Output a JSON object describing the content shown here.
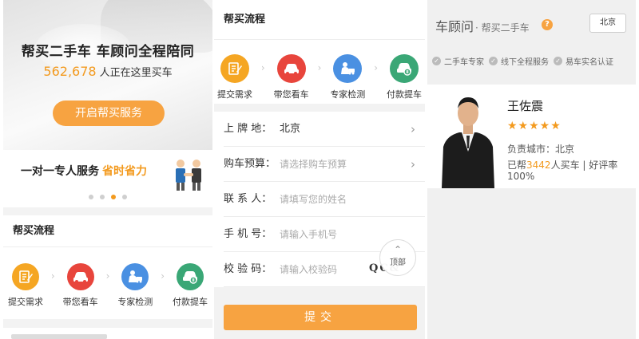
{
  "panel1": {
    "hero": {
      "title": "帮买二手车  车顾问全程陪同",
      "count": "562,678",
      "count_suffix": "人正在这里买车",
      "button": "开启帮买服务"
    },
    "promo": {
      "text": "一对一专人服务",
      "highlight": "省时省力",
      "active_dot": 3,
      "dot_count": 4
    },
    "section_title": "帮买流程",
    "steps": [
      {
        "label": "提交需求",
        "icon": "edit-form-icon",
        "color": "#f5a623"
      },
      {
        "label": "带您看车",
        "icon": "car-icon",
        "color": "#e8453c"
      },
      {
        "label": "专家检测",
        "icon": "inspection-icon",
        "color": "#4a90e2"
      },
      {
        "label": "付款提车",
        "icon": "car-payment-icon",
        "color": "#3aa776"
      }
    ]
  },
  "panel2": {
    "section_title": "帮买流程",
    "steps": [
      {
        "label": "提交需求",
        "icon": "edit-form-icon",
        "color": "#f5a623"
      },
      {
        "label": "带您看车",
        "icon": "car-icon",
        "color": "#e8453c"
      },
      {
        "label": "专家检测",
        "icon": "inspection-icon",
        "color": "#4a90e2"
      },
      {
        "label": "付款提车",
        "icon": "car-payment-icon",
        "color": "#3aa776"
      }
    ],
    "form": {
      "plate_label": "上 牌 地：",
      "plate_value": "北京",
      "budget_label": "购车预算：",
      "budget_placeholder": "请选择购车预算",
      "contact_label": "联 系 人：",
      "contact_placeholder": "请填写您的姓名",
      "phone_label": "手 机 号：",
      "phone_placeholder": "请输入手机号",
      "code_label": "校 验 码：",
      "code_placeholder": "请输入校验码",
      "captcha_text": "QC&"
    },
    "back_to_top": "顶部",
    "submit": "提交"
  },
  "panel3": {
    "title": "车顾问",
    "subtitle": "· 帮买二手车",
    "help_icon": "?",
    "city": "北京",
    "features": [
      "二手车专家",
      "线下全程服务",
      "易车实名认证"
    ],
    "advisor": {
      "name": "王佐震",
      "stars": "★★★★★",
      "city": "负责城市：北京",
      "stat_prefix": "已帮",
      "stat_num": "3442",
      "stat_suffix": "人买车 | 好评率",
      "rate": "100%"
    }
  }
}
